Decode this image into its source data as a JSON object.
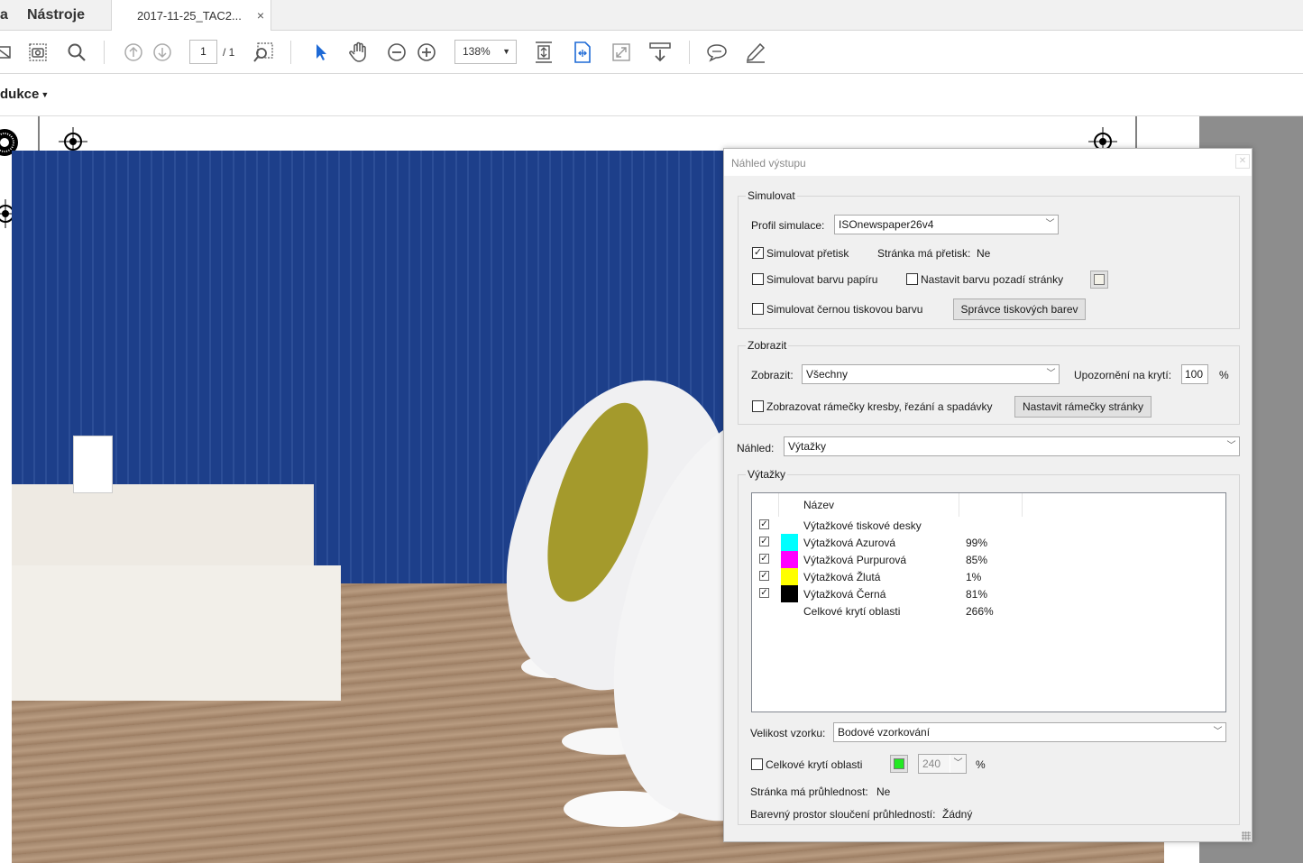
{
  "tabs": {
    "partial": "a",
    "tools": "Nástroje",
    "document": "2017-11-25_TAC2...",
    "close": "×"
  },
  "toolbar": {
    "page_current": "1",
    "page_total": "/ 1",
    "zoom": "138%",
    "icons": [
      "mail-icon",
      "snapshot-icon",
      "search-icon",
      "page-up-icon",
      "page-down-icon",
      "find-zoom-icon",
      "select-arrow-icon",
      "hand-icon",
      "zoom-out-icon",
      "zoom-in-icon",
      "fit-page-icon",
      "page-layout-icon",
      "full-screen-icon",
      "scroll-mode-icon",
      "comment-icon",
      "highlight-icon"
    ]
  },
  "secondary_bar": {
    "label": "dukce"
  },
  "dialog": {
    "title": "Náhled výstupu",
    "simulate": {
      "group_title": "Simulovat",
      "profile_label": "Profil simulace:",
      "profile_value": "ISOnewspaper26v4",
      "overprint_label": "Simulovat přetisk",
      "overprint_checked": true,
      "page_overprint_label": "Stránka má přetisk:",
      "page_overprint_value": "Ne",
      "paper_color_label": "Simulovat barvu papíru",
      "page_bg_label": "Nastavit barvu pozadí stránky",
      "black_ink_label": "Simulovat černou tiskovou barvu",
      "ink_manager_button": "Správce tiskových barev"
    },
    "show": {
      "group_title": "Zobrazit",
      "show_label": "Zobrazit:",
      "show_value": "Všechny",
      "warning_label": "Upozornění na krytí:",
      "warning_value": "100",
      "percent": "%",
      "boxes_label": "Zobrazovat rámečky kresby, řezání a spadávky",
      "boxes_button": "Nastavit rámečky stránky"
    },
    "preview": {
      "label": "Náhled:",
      "value": "Výtažky"
    },
    "separations": {
      "group_title": "Výtažky",
      "header_name": "Název",
      "rows": [
        {
          "name": "Výtažkové tiskové desky",
          "percent": "",
          "color": "",
          "checked": true
        },
        {
          "name": "Výtažková Azurová",
          "percent": "99%",
          "color": "#00ffff",
          "checked": true
        },
        {
          "name": "Výtažková Purpurová",
          "percent": "85%",
          "color": "#ff00ff",
          "checked": true
        },
        {
          "name": "Výtažková Žlutá",
          "percent": "1%",
          "color": "#ffff00",
          "checked": true
        },
        {
          "name": "Výtažková Černá",
          "percent": "81%",
          "color": "#000000",
          "checked": true
        },
        {
          "name": "Celkové krytí oblasti",
          "percent": "266%",
          "color": "",
          "checked": null
        }
      ]
    },
    "sample": {
      "label": "Velikost vzorku:",
      "value": "Bodové vzorkování"
    },
    "total_coverage": {
      "label": "Celkové krytí oblasti",
      "value": "240",
      "percent": "%",
      "swatch_color": "#22e822"
    },
    "transparency": {
      "label": "Stránka má průhlednost:",
      "value": "Ne"
    },
    "blend_space": {
      "label": "Barevný prostor sloučení průhledností:",
      "value": "Žádný"
    }
  }
}
